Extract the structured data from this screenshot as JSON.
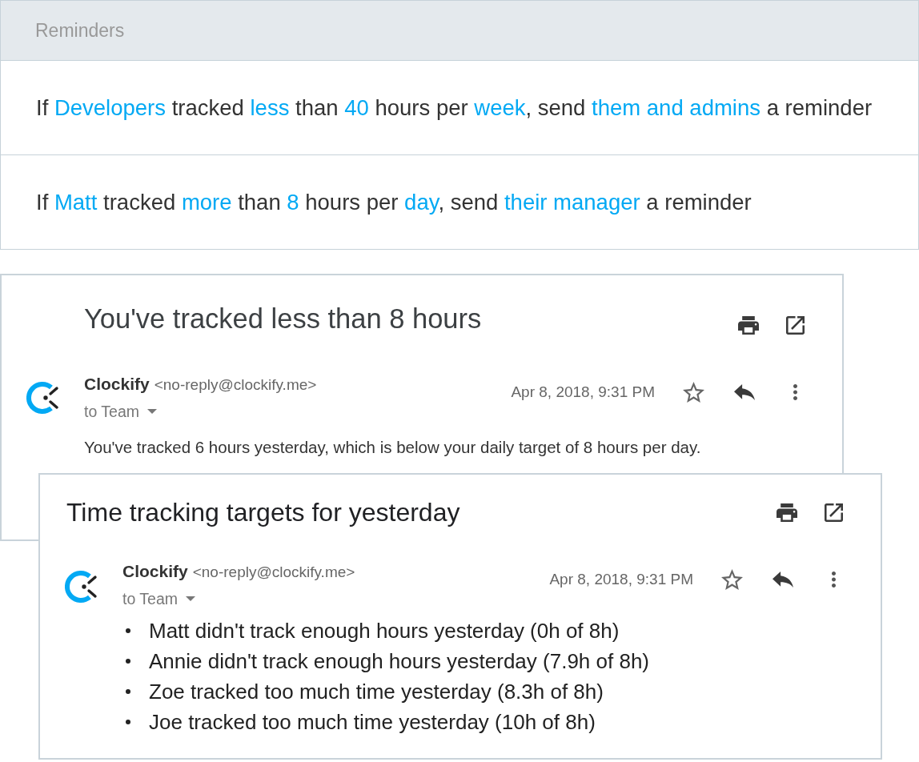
{
  "reminders": {
    "title": "Reminders",
    "rules": [
      {
        "parts": [
          {
            "kind": "text",
            "text": "If "
          },
          {
            "kind": "link",
            "text": "Developers"
          },
          {
            "kind": "text",
            "text": " tracked "
          },
          {
            "kind": "link",
            "text": "less"
          },
          {
            "kind": "text",
            "text": " than "
          },
          {
            "kind": "link",
            "text": "40"
          },
          {
            "kind": "text",
            "text": " hours per "
          },
          {
            "kind": "link",
            "text": "week"
          },
          {
            "kind": "text",
            "text": ", send "
          },
          {
            "kind": "link",
            "text": "them and admins"
          },
          {
            "kind": "text",
            "text": " a reminder"
          }
        ]
      },
      {
        "parts": [
          {
            "kind": "text",
            "text": "If "
          },
          {
            "kind": "link",
            "text": "Matt"
          },
          {
            "kind": "text",
            "text": " tracked "
          },
          {
            "kind": "link",
            "text": "more"
          },
          {
            "kind": "text",
            "text": " than "
          },
          {
            "kind": "link",
            "text": "8"
          },
          {
            "kind": "text",
            "text": " hours per "
          },
          {
            "kind": "link",
            "text": "day"
          },
          {
            "kind": "text",
            "text": ", send "
          },
          {
            "kind": "link",
            "text": "their manager"
          },
          {
            "kind": "text",
            "text": " a reminder"
          }
        ]
      }
    ]
  },
  "emails": [
    {
      "subject": "You've tracked less than 8 hours",
      "sender_name": "Clockify",
      "sender_email": "<no-reply@clockify.me>",
      "recipient": "to Team",
      "date": "Apr 8, 2018, 9:31 PM",
      "body": [
        {
          "kind": "paragraph",
          "text": "You've tracked 6 hours yesterday, which is below your daily target of 8 hours per day."
        }
      ]
    },
    {
      "subject": "Time tracking targets for yesterday",
      "sender_name": "Clockify",
      "sender_email": "<no-reply@clockify.me>",
      "recipient": "to Team",
      "date": "Apr 8, 2018, 9:31 PM",
      "body": [
        {
          "kind": "bullet",
          "text": "Matt didn't track enough hours yesterday (0h of 8h)"
        },
        {
          "kind": "bullet",
          "text": "Annie didn't track enough hours yesterday (7.9h of 8h)"
        },
        {
          "kind": "bullet",
          "text": "Zoe tracked too much time yesterday (8.3h of 8h)"
        },
        {
          "kind": "bullet",
          "text": "Joe tracked too much time yesterday (10h of 8h)"
        }
      ]
    }
  ]
}
